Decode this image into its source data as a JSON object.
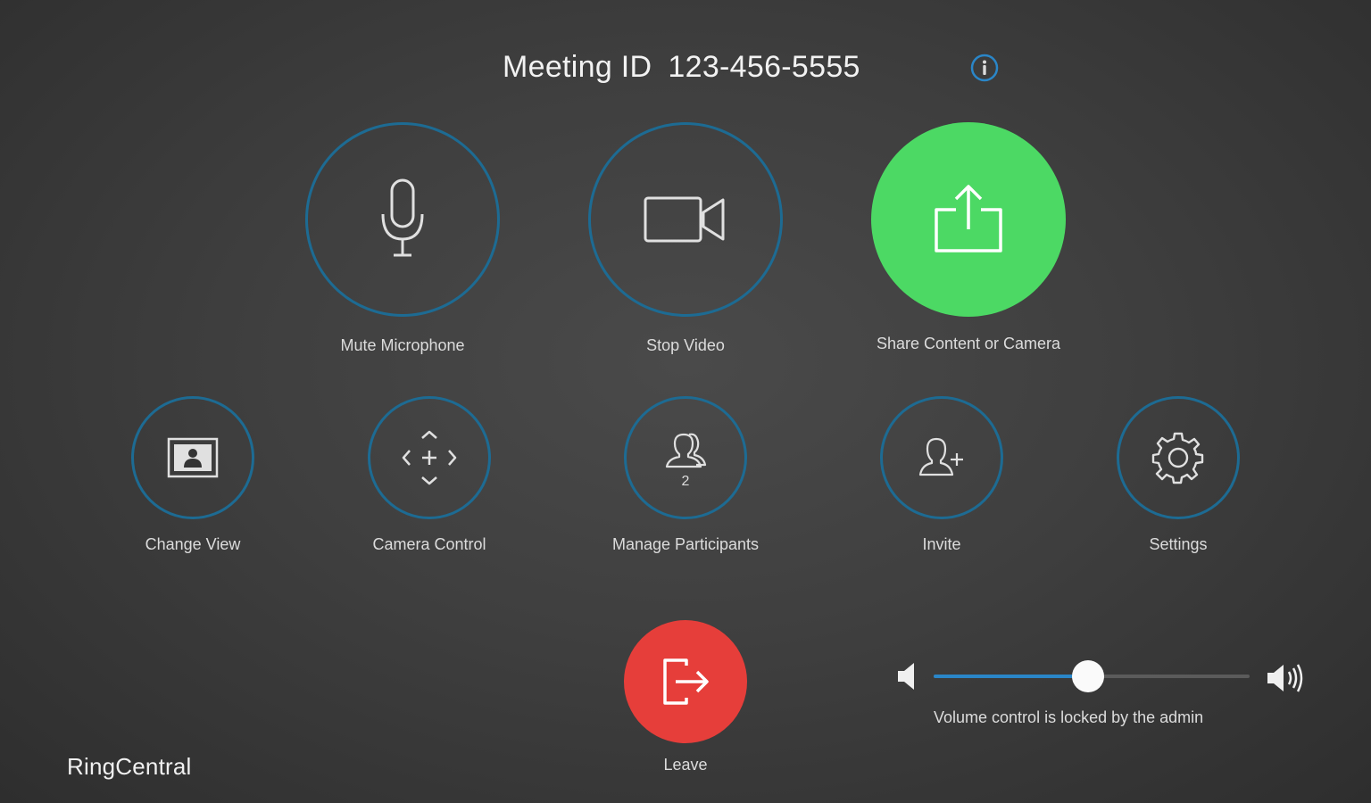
{
  "header": {
    "meeting_id_label": "Meeting ID",
    "meeting_id_value": "123-456-5555",
    "info_icon": "info-icon"
  },
  "primary_controls": {
    "mute": {
      "label": "Mute Microphone",
      "icon": "microphone-icon"
    },
    "video": {
      "label": "Stop Video",
      "icon": "video-camera-icon"
    },
    "share": {
      "label": "Share Content or Camera",
      "icon": "share-icon"
    }
  },
  "secondary_controls": {
    "change_view": {
      "label": "Change View",
      "icon": "change-view-icon"
    },
    "camera_control": {
      "label": "Camera Control",
      "icon": "camera-control-icon"
    },
    "manage_participants": {
      "label": "Manage Participants",
      "icon": "participants-icon",
      "count": "2"
    },
    "invite": {
      "label": "Invite",
      "icon": "add-user-icon"
    },
    "settings": {
      "label": "Settings",
      "icon": "gear-icon"
    }
  },
  "leave": {
    "label": "Leave",
    "icon": "leave-icon"
  },
  "volume": {
    "level": 0.49,
    "note": "Volume control is locked by the admin"
  },
  "brand": {
    "name": "RingCentral"
  },
  "colors": {
    "accent_ring": "#1d6b93",
    "share_green": "#4cd964",
    "leave_red": "#e63e3a",
    "slider_blue": "#2a86c8"
  }
}
